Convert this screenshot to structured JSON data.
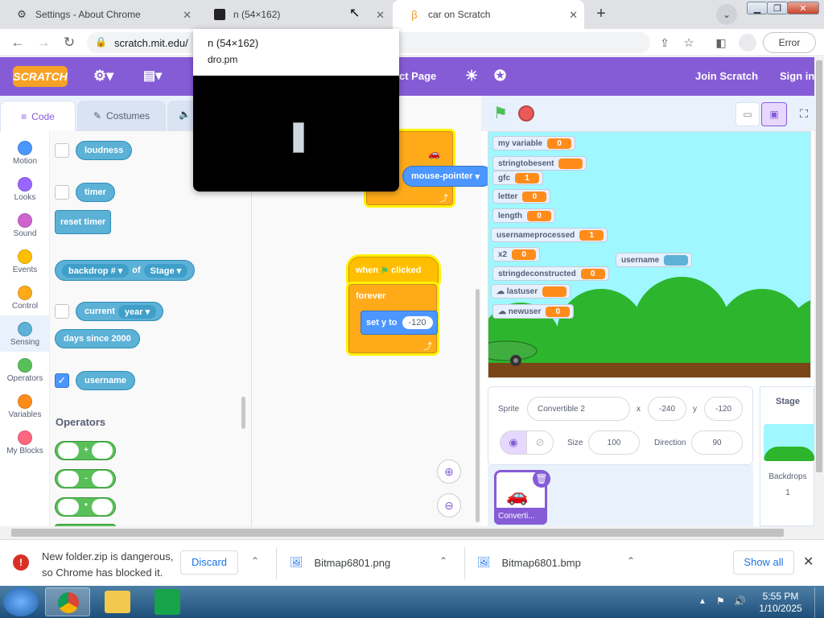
{
  "tabs": [
    {
      "title": "Settings - About Chrome",
      "icon": "gear-icon"
    },
    {
      "title": "n (54×162)",
      "icon": "window-icon"
    },
    {
      "title": "car on Scratch",
      "icon": "scratch-favicon"
    }
  ],
  "tooltip": {
    "title": "n (54×162)",
    "subtitle": "dro.pm"
  },
  "toolbar": {
    "url": "scratch.mit.edu/",
    "error_label": "Error"
  },
  "scratch_header": {
    "logo": "SCRATCH",
    "project_page": "ct Page",
    "join": "Join Scratch",
    "signin": "Sign in"
  },
  "editor_tabs": {
    "code": "Code",
    "costumes": "Costumes"
  },
  "categories": [
    {
      "label": "Motion",
      "color": "#4c97ff"
    },
    {
      "label": "Looks",
      "color": "#9966ff"
    },
    {
      "label": "Sound",
      "color": "#cf63cf"
    },
    {
      "label": "Events",
      "color": "#ffbf00"
    },
    {
      "label": "Control",
      "color": "#ffab19"
    },
    {
      "label": "Sensing",
      "color": "#5cb1d6"
    },
    {
      "label": "Operators",
      "color": "#59c059"
    },
    {
      "label": "Variables",
      "color": "#ff8c1a"
    },
    {
      "label": "My Blocks",
      "color": "#ff6680"
    }
  ],
  "palette": {
    "loudness": "loudness",
    "timer": "timer",
    "reset_timer": "reset timer",
    "backdrop_of": {
      "a": "backdrop #",
      "of": "of",
      "b": "Stage"
    },
    "current": {
      "label": "current",
      "option": "year"
    },
    "days_since": "days since 2000",
    "username": "username",
    "operators_heading": "Operators",
    "operators": [
      "+",
      "-",
      "*"
    ]
  },
  "script": {
    "mouse_pointer": "mouse-pointer",
    "when_flag": {
      "when": "when",
      "clicked": "clicked"
    },
    "forever": "forever",
    "set_y": {
      "label": "set y to",
      "value": "-120"
    }
  },
  "monitors": [
    {
      "name": "my variable",
      "value": "0"
    },
    {
      "name": "stringtobesent",
      "value": ""
    },
    {
      "name": "gfc",
      "value": "1"
    },
    {
      "name": "letter",
      "value": "0"
    },
    {
      "name": "length",
      "value": "0"
    },
    {
      "name": "usernameprocessed",
      "value": "1"
    },
    {
      "name": "x2",
      "value": "0"
    },
    {
      "name": "stringdeconstructed",
      "value": "0"
    },
    {
      "name": "lastuser",
      "value": ""
    },
    {
      "name": "newuser",
      "value": "0"
    },
    {
      "name": "username",
      "value": ""
    }
  ],
  "sprite_info": {
    "sprite_label": "Sprite",
    "sprite_name": "Convertible 2",
    "x_label": "x",
    "x": "-240",
    "y_label": "y",
    "y": "-120",
    "show_label": "",
    "size_label": "Size",
    "size": "100",
    "direction_label": "Direction",
    "direction": "90"
  },
  "sprite_thumb": "Converti...",
  "stage_panel": {
    "title": "Stage",
    "backdrops_label": "Backdrops",
    "backdrops_count": "1"
  },
  "downloads": [
    {
      "name": "New folder.zip is dangerous,",
      "name2": "so Chrome has blocked it.",
      "action": "Discard"
    },
    {
      "name": "Bitmap6801.png"
    },
    {
      "name": "Bitmap6801.bmp"
    }
  ],
  "show_all": "Show all",
  "clock": {
    "time": "5:55 PM",
    "date": "1/10/2025"
  }
}
